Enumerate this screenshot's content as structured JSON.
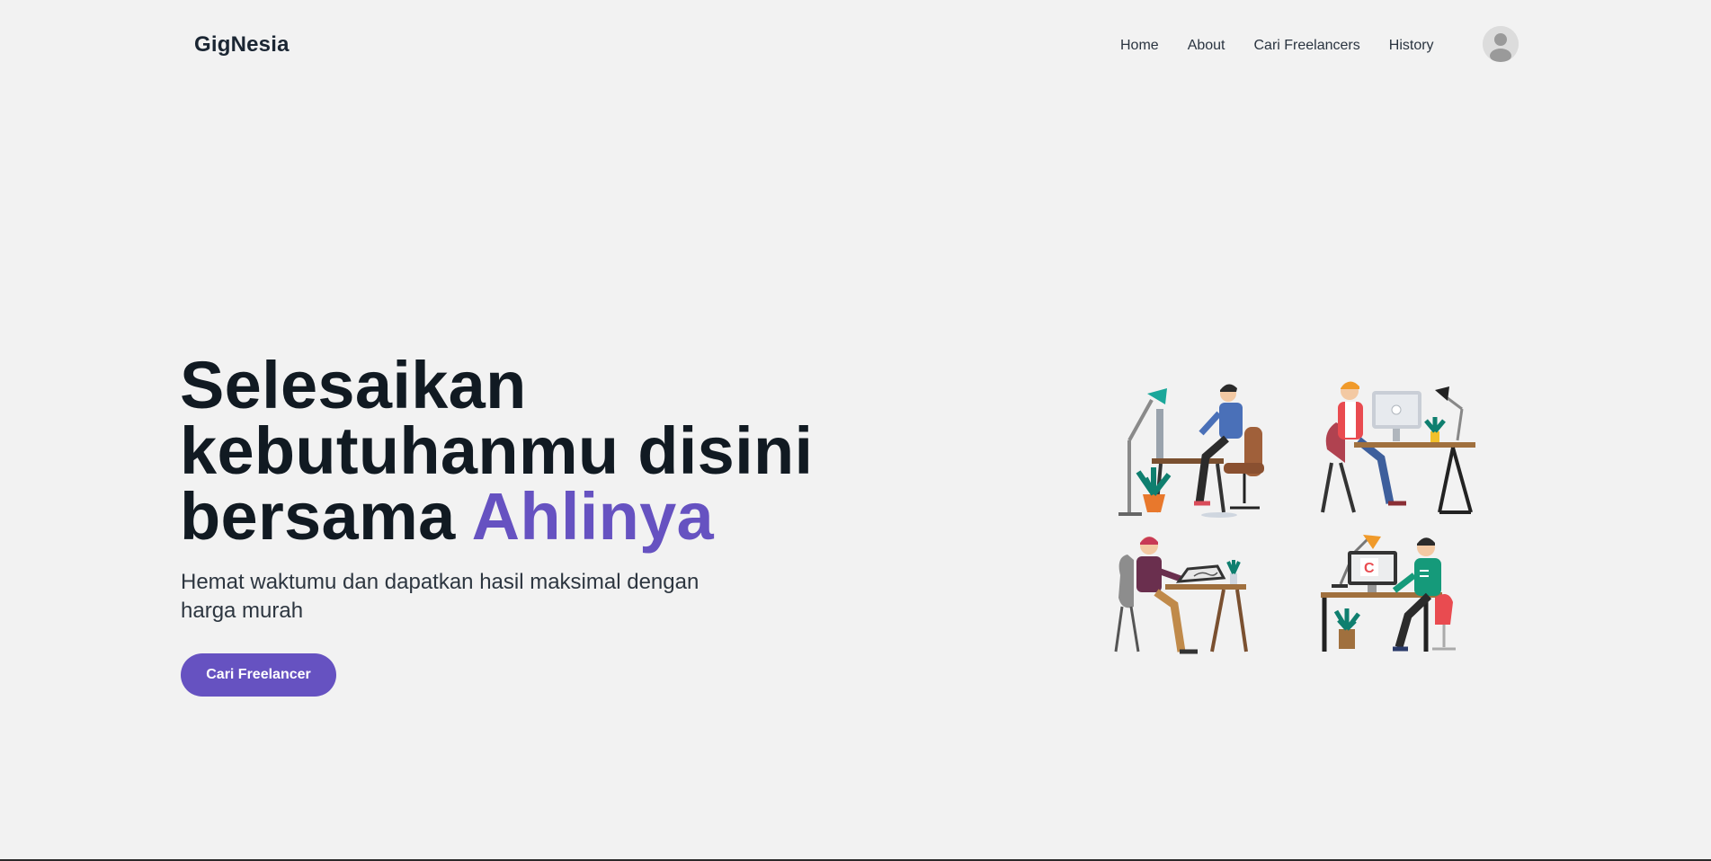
{
  "nav": {
    "brand": "GigNesia",
    "links": [
      "Home",
      "About",
      "Cari Freelancers",
      "History"
    ]
  },
  "hero": {
    "title_line1": "Selesaikan",
    "title_line2": "kebutuhanmu disini",
    "title_line3_plain": "bersama ",
    "title_line3_accent": "Ahlinya",
    "subtitle": "Hemat waktumu dan dapatkan hasil maksimal dengan harga murah",
    "cta_label": "Cari Freelancer"
  },
  "colors": {
    "background": "#f2f2f2",
    "accent": "#6652c1",
    "text": "#111a22"
  },
  "icons": {
    "avatar": "user-avatar-icon",
    "illustration": "freelancers-at-desks-illustration"
  }
}
